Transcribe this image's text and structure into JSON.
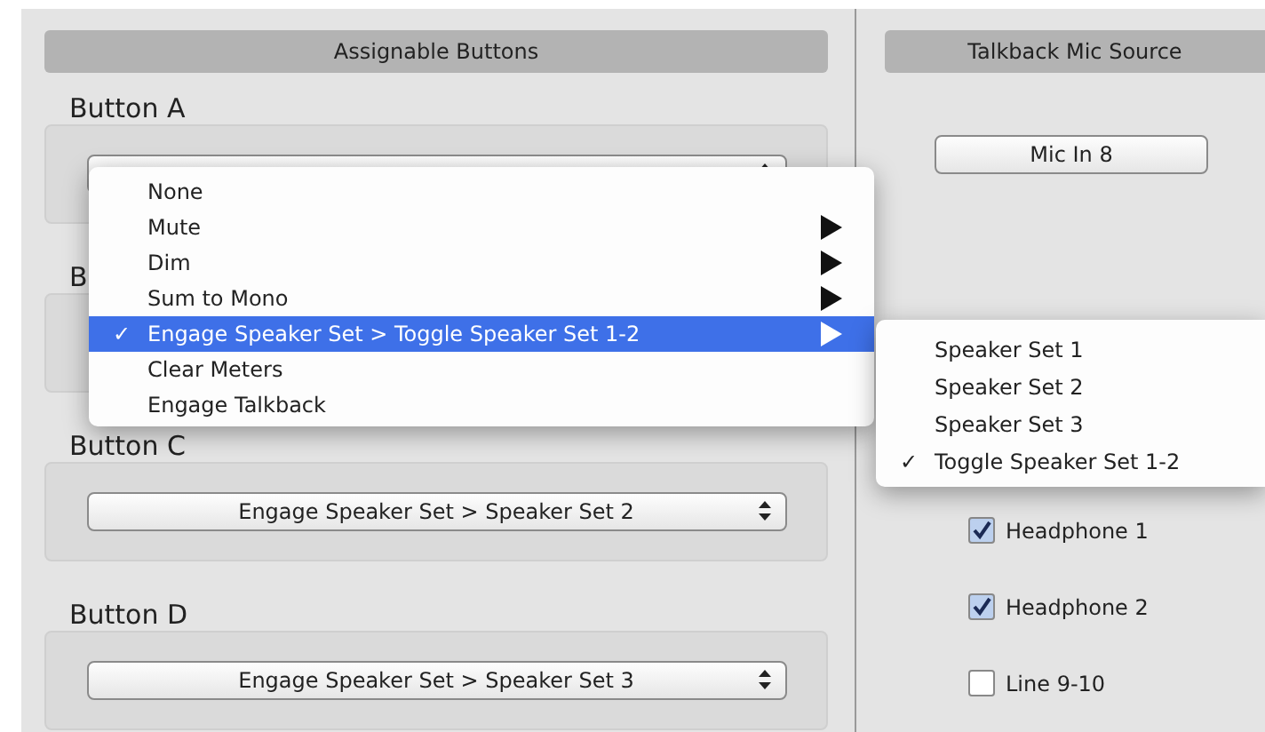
{
  "assignable": {
    "title": "Assignable Buttons",
    "groups": [
      {
        "label": "Button A",
        "covered": false
      },
      {
        "label": "B",
        "covered": true
      },
      {
        "label": "Button C",
        "value": "Engage Speaker Set > Speaker Set 2",
        "covered": false
      },
      {
        "label": "Button D",
        "value": "Engage Speaker Set > Speaker Set 3",
        "covered": false
      }
    ]
  },
  "talkback": {
    "title": "Talkback Mic Source",
    "source_button": "Mic In 8",
    "outputs": [
      {
        "label": "Headphone 1",
        "checked": true
      },
      {
        "label": "Headphone 2",
        "checked": true
      },
      {
        "label": "Line 9-10",
        "checked": false
      }
    ]
  },
  "menu": {
    "items": [
      {
        "label": "None",
        "checked": false,
        "submenu": false,
        "selected": false
      },
      {
        "label": "Mute",
        "checked": false,
        "submenu": true,
        "selected": false
      },
      {
        "label": "Dim",
        "checked": false,
        "submenu": true,
        "selected": false
      },
      {
        "label": "Sum to Mono",
        "checked": false,
        "submenu": true,
        "selected": false
      },
      {
        "label": "Engage Speaker Set > Toggle Speaker Set 1-2",
        "checked": true,
        "submenu": true,
        "selected": true
      },
      {
        "label": "Clear Meters",
        "checked": false,
        "submenu": false,
        "selected": false
      },
      {
        "label": "Engage Talkback",
        "checked": false,
        "submenu": false,
        "selected": false
      }
    ]
  },
  "submenu": {
    "items": [
      {
        "label": "Speaker Set 1",
        "checked": false
      },
      {
        "label": "Speaker Set 2",
        "checked": false
      },
      {
        "label": "Speaker Set 3",
        "checked": false
      },
      {
        "label": "Toggle Speaker Set 1-2",
        "checked": true
      }
    ]
  },
  "check_mark": "✓"
}
